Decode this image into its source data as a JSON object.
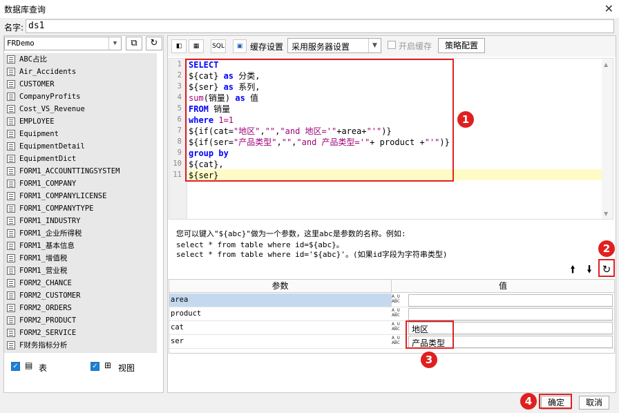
{
  "window": {
    "title": "数据库查询"
  },
  "name_field": {
    "label": "名字:",
    "value": "ds1"
  },
  "left_panel": {
    "db_select": "FRDemo",
    "tables": [
      "ABC占比",
      "Air_Accidents",
      "CUSTOMER",
      "CompanyProfits",
      "Cost_VS_Revenue",
      "EMPLOYEE",
      "Equipment",
      "EquipmentDetail",
      "EquipmentDict",
      "FORM1_ACCOUNTTINGSYSTEM",
      "FORM1_COMPANY",
      "FORM1_COMPANYLICENSE",
      "FORM1_COMPANYTYPE",
      "FORM1_INDUSTRY",
      "FORM1_企业所得税",
      "FORM1_基本信息",
      "FORM1_增值税",
      "FORM1_营业税",
      "FORM2_CHANCE",
      "FORM2_CUSTOMER",
      "FORM2_ORDERS",
      "FORM2_PRODUCT",
      "FORM2_SERVICE",
      "F财务指标分析"
    ],
    "check_table": "表",
    "check_view": "视图"
  },
  "toolbar": {
    "cache_label": "缓存设置",
    "cache_select": "采用服务器设置",
    "enable_cache": "开启缓存",
    "policy_button": "策略配置"
  },
  "editor": {
    "line_numbers": [
      "1",
      "2",
      "3",
      "4",
      "5",
      "6",
      "7",
      "8",
      "9",
      "10",
      "11"
    ],
    "lines": [
      [
        {
          "t": "SELECT",
          "c": "kw"
        }
      ],
      [
        {
          "t": "${cat} ",
          "c": ""
        },
        {
          "t": "as",
          "c": "kw"
        },
        {
          "t": " 分类,",
          "c": ""
        }
      ],
      [
        {
          "t": "${ser} ",
          "c": ""
        },
        {
          "t": "as",
          "c": "kw"
        },
        {
          "t": " 系列,",
          "c": ""
        }
      ],
      [
        {
          "t": "sum",
          "c": "fn"
        },
        {
          "t": "(销量) ",
          "c": ""
        },
        {
          "t": "as",
          "c": "kw"
        },
        {
          "t": " 值",
          "c": ""
        }
      ],
      [
        {
          "t": "FROM",
          "c": "kw"
        },
        {
          "t": " 销量",
          "c": ""
        }
      ],
      [
        {
          "t": "where",
          "c": "kw"
        },
        {
          "t": " 1=1",
          "c": "str"
        }
      ],
      [
        {
          "t": "${if(cat=",
          "c": ""
        },
        {
          "t": "\"地区\"",
          "c": "str"
        },
        {
          "t": ",",
          "c": ""
        },
        {
          "t": "\"\"",
          "c": "str"
        },
        {
          "t": ",",
          "c": ""
        },
        {
          "t": "\"and 地区='\"",
          "c": "str"
        },
        {
          "t": "+area+",
          "c": ""
        },
        {
          "t": "\"'\"",
          "c": "str"
        },
        {
          "t": ")}",
          "c": ""
        }
      ],
      [
        {
          "t": "${if(ser=",
          "c": ""
        },
        {
          "t": "\"产品类型\"",
          "c": "str"
        },
        {
          "t": ",",
          "c": ""
        },
        {
          "t": "\"\"",
          "c": "str"
        },
        {
          "t": ",",
          "c": ""
        },
        {
          "t": "\"and 产品类型='\"",
          "c": "str"
        },
        {
          "t": "+ product +",
          "c": ""
        },
        {
          "t": "\"'\"",
          "c": "str"
        },
        {
          "t": ")}",
          "c": ""
        }
      ],
      [
        {
          "t": "group by",
          "c": "kw"
        }
      ],
      [
        {
          "t": "${cat},",
          "c": ""
        }
      ],
      [
        {
          "t": "${ser}",
          "c": ""
        }
      ]
    ]
  },
  "hint": {
    "line1": "您可以键入\"${abc}\"做为一个参数，这里abc是参数的名称。例如:",
    "line2": "select * from table where id=${abc}。",
    "line3": "select * from table where id='${abc}'。(如果id字段为字符串类型)"
  },
  "params": {
    "header_name": "参数",
    "header_value": "值",
    "type_glyph": "A̲U ABC",
    "rows": [
      {
        "name": "area",
        "value": ""
      },
      {
        "name": "product",
        "value": ""
      },
      {
        "name": "cat",
        "value": "地区"
      },
      {
        "name": "ser",
        "value": "产品类型"
      }
    ]
  },
  "badges": [
    "1",
    "2",
    "3",
    "4"
  ],
  "buttons": {
    "ok": "确定",
    "cancel": "取消"
  },
  "colors": {
    "annotation_red": "#e02020",
    "checkbox_blue": "#1e7fd4",
    "selected_row": "#c5d9ee",
    "current_line": "#fefbc6"
  }
}
